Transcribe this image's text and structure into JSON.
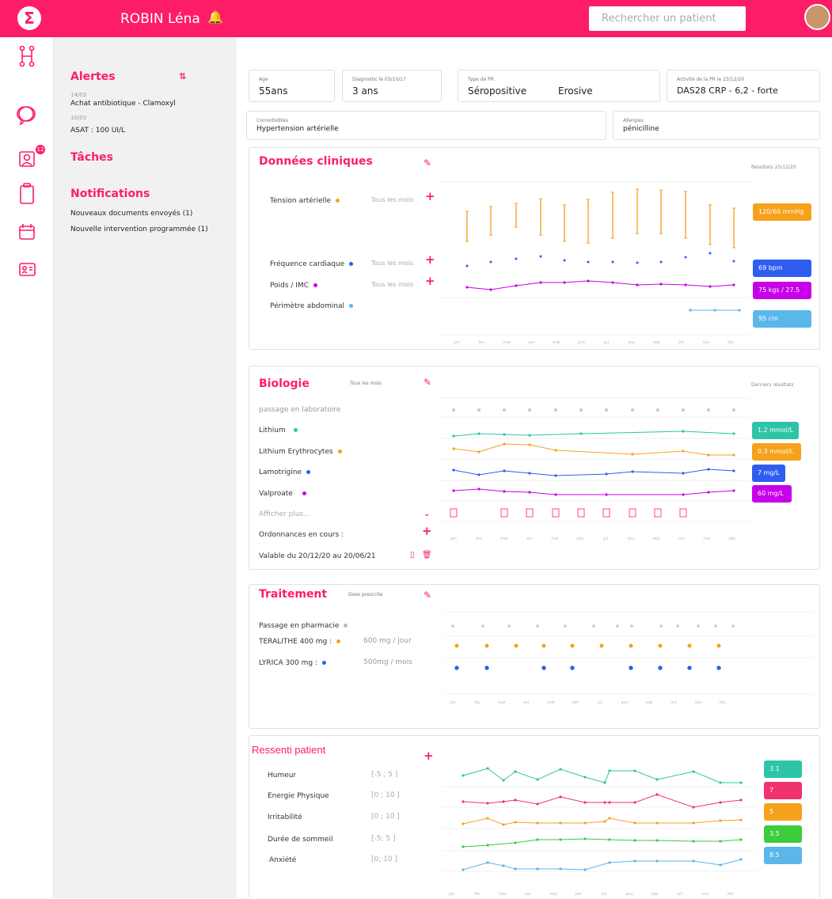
{
  "header": {
    "logo": "Σ",
    "patient_name": "ROBIN Léna",
    "bell": "🔔",
    "search_placeholder": "Rechercher un patient"
  },
  "sidebar_icons": [
    "network-icon",
    "chat-icon",
    "profile-icon",
    "clipboard-icon",
    "calendar-icon",
    "id-card-icon"
  ],
  "left": {
    "alerts_title": "Alertes",
    "alerts_filter": "⇅",
    "alert1_date": "14/03",
    "alert1_text": "Achat antibiotique - Clamoxyl",
    "alert2_date": "10/03",
    "alert2_text": "ASAT : 100 UI/L",
    "tasks_title": "Tâches",
    "notif_title": "Notifications",
    "notif1": "Nouveaux documents envoyés (1)",
    "notif2": "Nouvelle intervention programmée (1)"
  },
  "info": {
    "age_label": "Age",
    "age_value": "55ans",
    "diag_label": "Diagnostic le 03/10/17",
    "diag_value": "3 ans",
    "type_label": "Type de PR",
    "type_value": "Séropositive",
    "type_value2": "Erosive",
    "activity_label": "Activité de la PR le 23/12/20",
    "activity_value": "DAS28 CRP - 6,2 - forte",
    "comorb_label": "Comorbidités",
    "comorb_value": "Hypertension artérielle",
    "allergy_label": "Allergies",
    "allergy_value": "pénicilline"
  },
  "clinical": {
    "title": "Données cliniques",
    "results": "Résultats 25/12/20",
    "row1": "Tension artérielle",
    "row1_freq": "Tous les mois",
    "row2": "Fréquence cardiaque",
    "row2_freq": "Tous les mois",
    "row3": "Poids / IMC",
    "row3_freq": "Tous les mois",
    "row4": "Périmètre abdominal",
    "pill1": "120/60 mmHg",
    "pill2": "69 bpm",
    "pill3": "75 kgs / 27.5",
    "pill4": "95 cm",
    "months": [
      "jan",
      "fev",
      "mar",
      "avr",
      "mai",
      "juin",
      "jul",
      "aou",
      "sep",
      "oct",
      "nov",
      "dec"
    ]
  },
  "biologie": {
    "title": "Biologie",
    "freq": "Tous les mois",
    "results": "Derniers résultats",
    "lab_row": "passage en laboratoire",
    "row1": "Lithium",
    "row2": "Lithium Erythrocytes",
    "row3": "Lamotrigine",
    "row4": "Valproate",
    "more": "Afficher plus...",
    "orders": "Ordonnances en cours :",
    "valid": "Valable du 20/12/20 au 20/06/21",
    "pill1": "1.2 mmol/L",
    "pill2": "0.3 mmol/L",
    "pill3": "7 mg/L",
    "pill4": "60 mg/L",
    "months": [
      "jan",
      "fev",
      "mar",
      "avr",
      "mai",
      "juin",
      "jul",
      "aou",
      "sep",
      "oct",
      "nov",
      "dec"
    ]
  },
  "traitement": {
    "title": "Traitement",
    "sub": "Dose prescrite",
    "row0": "Passage en pharmacie",
    "row1": "TERALITHE 400 mg :",
    "row1_dose": "600 mg / jour",
    "row2": "LYRICA 300 mg :",
    "row2_dose": "500mg / mois",
    "months": [
      "jan",
      "fev",
      "mar",
      "avr",
      "mai",
      "juin",
      "jul",
      "aou",
      "sep",
      "oct",
      "nov",
      "dec"
    ]
  },
  "ressenti": {
    "title": "Ressenti patient",
    "row1": "Humeur",
    "row1_range": "[-5 ; 5 ]",
    "row2": "Energie Physique",
    "row2_range": "[0 ; 10 ]",
    "row3": "Irritabilité",
    "row3_range": "[0 ; 10 ]",
    "row4": "Durée de sommeil",
    "row4_range": "[-5; 5 ]",
    "row5": "Anxiété",
    "row5_range": "[0; 10 ]",
    "pill1": "3.1",
    "pill2": "7",
    "pill3": "5",
    "pill4": "3.5",
    "pill5": "8.5",
    "months": [
      "jan",
      "fev",
      "mar",
      "avr",
      "mai",
      "juin",
      "jul",
      "aou",
      "sep",
      "oct",
      "nov",
      "dec"
    ]
  },
  "colors": {
    "accent": "#fd1d66",
    "orange": "#f6a11c",
    "blue": "#2f5df0",
    "purple": "#c800e8",
    "lightblue": "#5bb6ea",
    "teal": "#2ec4a7",
    "pink": "#f0326e",
    "green": "#3ccc3c"
  }
}
